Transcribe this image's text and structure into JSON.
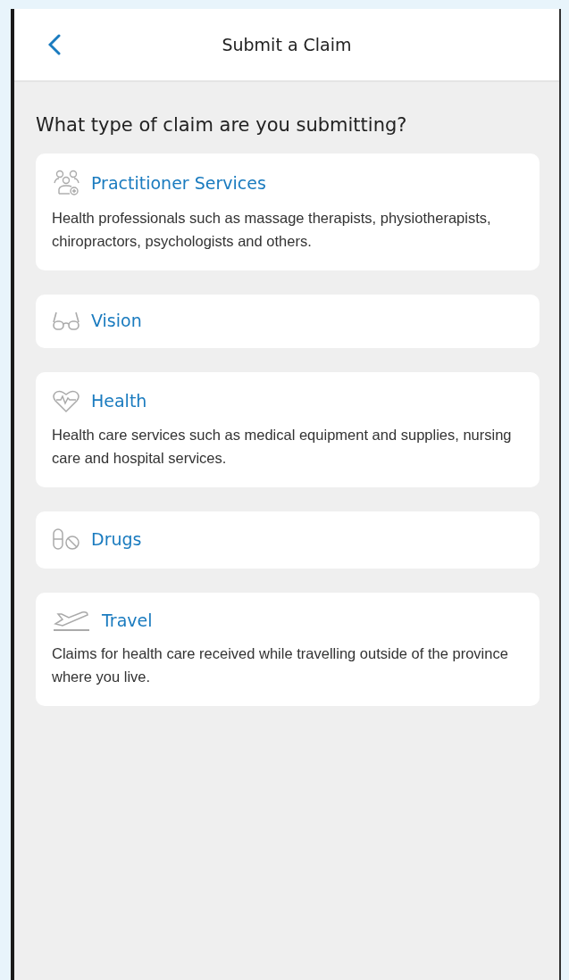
{
  "header": {
    "title": "Submit a Claim"
  },
  "question": "What type of claim are you submitting?",
  "claim_types": [
    {
      "title": "Practitioner Services",
      "description": "Health professionals such as massage therapists, physiotherapists, chiropractors, psychologists and others."
    },
    {
      "title": "Vision"
    },
    {
      "title": "Health",
      "description": "Health care services such as medical equipment and supplies, nursing care and hospital services."
    },
    {
      "title": "Drugs"
    },
    {
      "title": "Travel",
      "description": "Claims for health care received while travelling outside of the province where you live."
    }
  ]
}
